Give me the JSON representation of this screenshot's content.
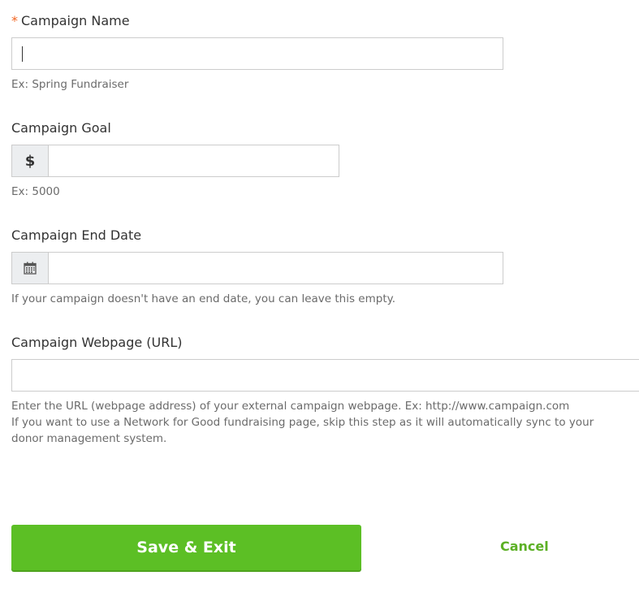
{
  "form": {
    "campaign_name": {
      "required_mark": "*",
      "label": "Campaign Name",
      "value": "",
      "hint": "Ex: Spring Fundraiser"
    },
    "campaign_goal": {
      "label": "Campaign Goal",
      "prefix": "$",
      "value": "",
      "hint": "Ex: 5000"
    },
    "campaign_end_date": {
      "label": "Campaign End Date",
      "icon": "calendar-icon",
      "value": "",
      "hint": "If your campaign doesn't have an end date, you can leave this empty."
    },
    "campaign_webpage": {
      "label": "Campaign Webpage (URL)",
      "value": "",
      "hint_line1": "Enter the URL (webpage address) of your external campaign webpage. Ex: http://www.campaign.com",
      "hint_line2": "If you want to use a Network for Good fundraising page, skip this step as it will automatically sync to your donor management system."
    }
  },
  "actions": {
    "save_label": "Save & Exit",
    "cancel_label": "Cancel"
  },
  "colors": {
    "required": "#f26522",
    "primary_button": "#5cbf25",
    "cancel_link": "#5cb025"
  }
}
